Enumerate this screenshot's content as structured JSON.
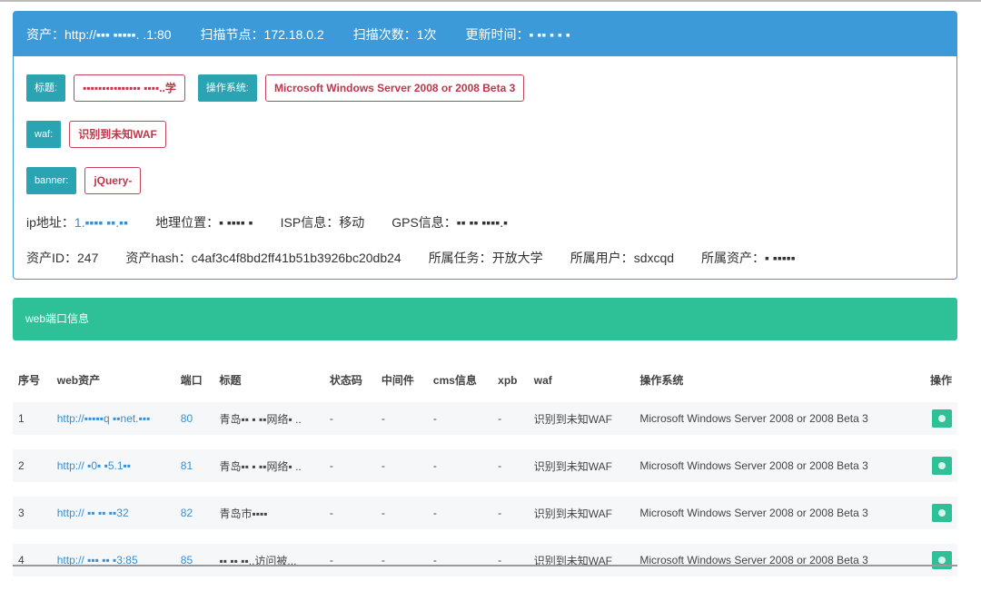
{
  "asset_panel": {
    "header": {
      "asset_label": "资产：",
      "asset_value": "http://▪▪▪ ▪▪▪▪▪. .1:80",
      "node_label": "扫描节点：",
      "node_value": "172.18.0.2",
      "count_label": "扫描次数：",
      "count_value": "1次",
      "time_label": "更新时间：",
      "time_value": "▪ ▪▪ ▪ ▪ ▪"
    },
    "title_label": "标题:",
    "title_value": "▪▪▪▪▪▪▪▪▪▪▪▪▪▪▪ ▪▪▪▪..学",
    "os_label": "操作系统:",
    "os_value": "Microsoft Windows Server 2008 or 2008 Beta 3",
    "waf_label": "waf:",
    "waf_value": "识别到未知WAF",
    "banner_label": "banner:",
    "banner_value": "jQuery-",
    "ip_label": "ip地址：",
    "ip_value": "1.▪▪▪▪ ▪▪.▪▪",
    "geo_label": "地理位置：",
    "geo_value": "▪ ▪▪▪▪ ▪",
    "isp_label": "ISP信息：",
    "isp_value": "移动",
    "gps_label": "GPS信息：",
    "gps_value": "▪▪ ▪▪ ▪▪▪▪.▪",
    "id_label": "资产ID：",
    "id_value": "247",
    "hash_label": "资产hash：",
    "hash_value": "c4af3c4f8bd2ff41b51b3926bc20db24",
    "task_label": "所属任务：",
    "task_value": "开放大学",
    "user_label": "所属用户：",
    "user_value": "sdxcqd",
    "owner_label": "所属资产：",
    "owner_value": "▪ ▪▪▪▪▪"
  },
  "web_panel": {
    "title": "web端口信息"
  },
  "colors": {
    "header_blue": "#3d9ad9",
    "label_teal": "#2aa3b3",
    "tag_red": "#c0364a",
    "green": "#2ec096"
  },
  "table": {
    "columns": [
      "序号",
      "web资产",
      "端口",
      "标题",
      "状态码",
      "中间件",
      "cms信息",
      "xpb",
      "waf",
      "操作系统",
      "操作"
    ],
    "rows": [
      {
        "no": "1",
        "url": "http://▪▪▪▪▪q ▪▪net.▪▪▪",
        "port": "80",
        "title": "青岛▪▪ ▪ ▪▪网络▪ ..",
        "status": "-",
        "middleware": "-",
        "cms": "-",
        "xpb": "-",
        "waf": "识别到未知WAF",
        "os": "Microsoft Windows Server 2008 or 2008 Beta 3",
        "action_icon": "eye-icon"
      },
      {
        "no": "2",
        "url": "http:// ▪0▪ ▪5.1▪▪",
        "port": "81",
        "title": "青岛▪▪ ▪ ▪▪网络▪ ..",
        "status": "-",
        "middleware": "-",
        "cms": "-",
        "xpb": "-",
        "waf": "识别到未知WAF",
        "os": "Microsoft Windows Server 2008 or 2008 Beta 3",
        "action_icon": "eye-icon"
      },
      {
        "no": "3",
        "url": "http:// ▪▪ ▪▪ ▪▪32",
        "port": "82",
        "title": "青岛市▪▪▪▪",
        "status": "-",
        "middleware": "-",
        "cms": "-",
        "xpb": "-",
        "waf": "识别到未知WAF",
        "os": "Microsoft Windows Server 2008 or 2008 Beta 3",
        "action_icon": "eye-icon"
      },
      {
        "no": "4",
        "url": "http:// ▪▪▪ ▪▪ ▪3:85",
        "port": "85",
        "title": "▪▪ ▪▪ ▪▪..访问被...",
        "status": "-",
        "middleware": "-",
        "cms": "-",
        "xpb": "-",
        "waf": "识别到未知WAF",
        "os": "Microsoft Windows Server 2008 or 2008 Beta 3",
        "action_icon": "eye-icon"
      }
    ]
  }
}
